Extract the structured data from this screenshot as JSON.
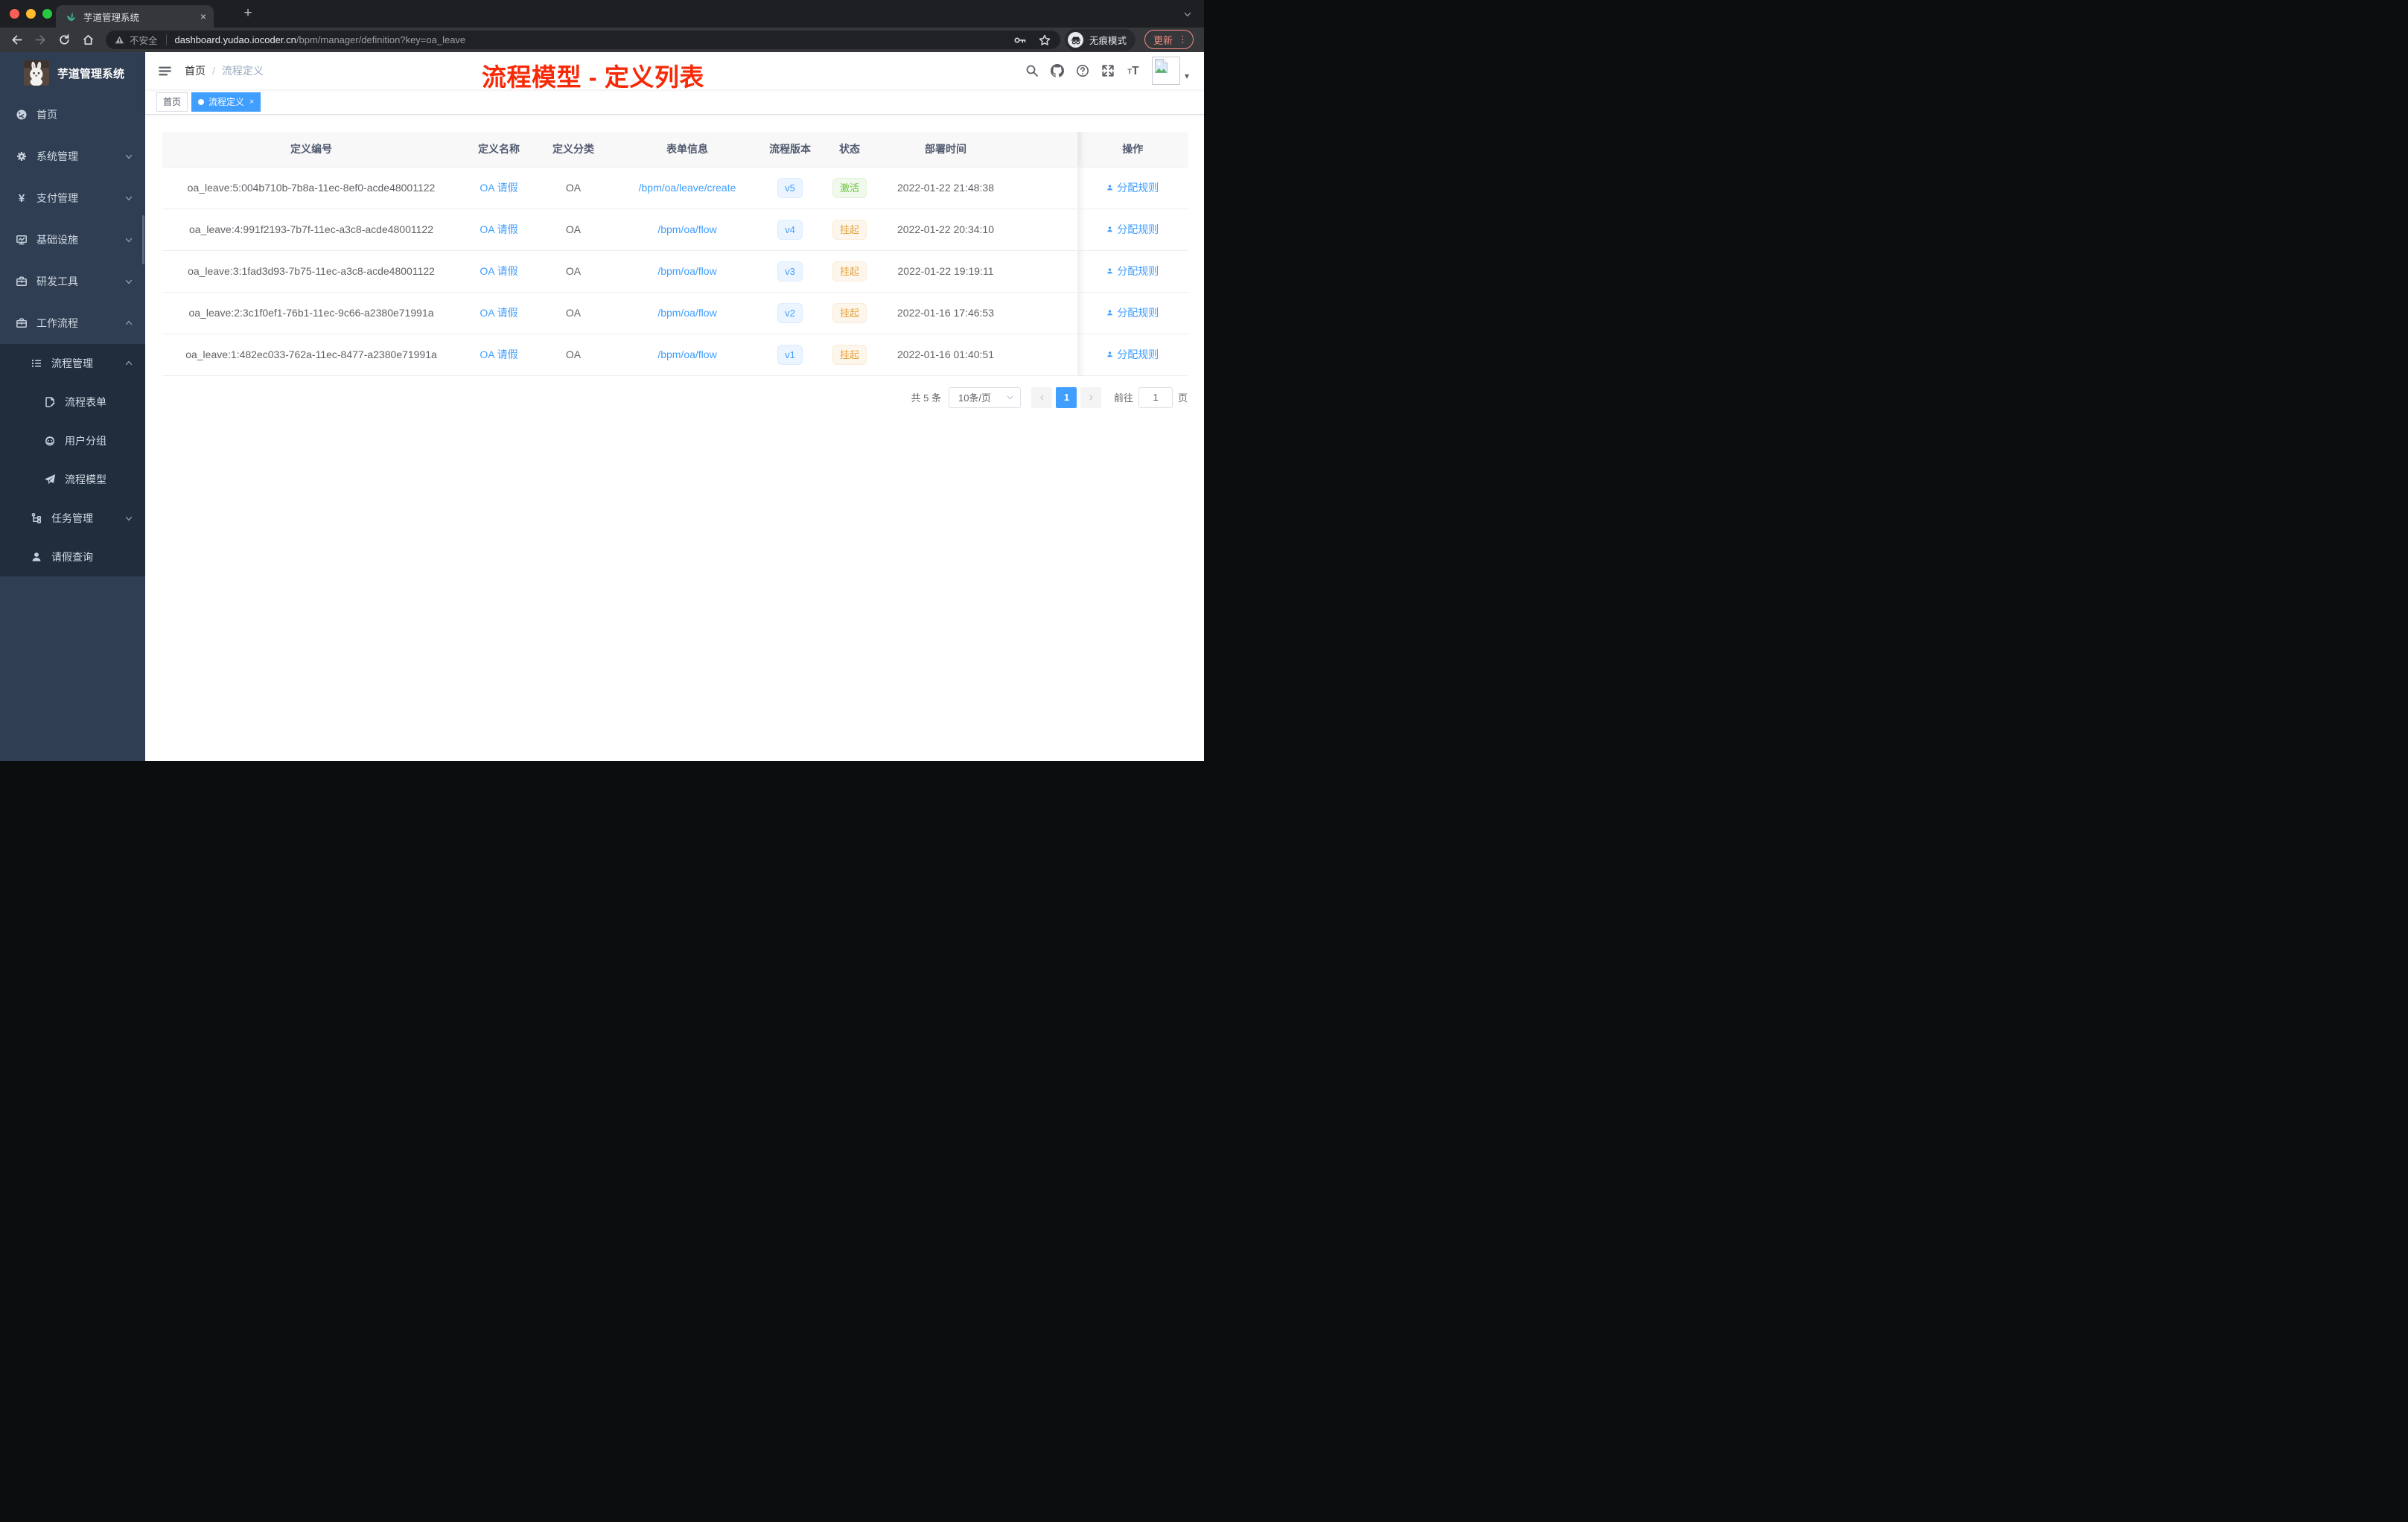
{
  "browser": {
    "tab": {
      "title": "芋道管理系统",
      "close": "×",
      "new_tab": "+",
      "favicon": "plant-icon"
    },
    "toolbar": {
      "security_label": "不安全",
      "url_host": "dashboard.yudao.iocoder.cn",
      "url_path": "/bpm/manager/definition?key=oa_leave",
      "incognito_label": "无痕模式",
      "update_label": "更新",
      "icons": [
        "back-icon",
        "forward-icon",
        "reload-icon",
        "home-icon",
        "warning-icon",
        "key-icon",
        "star-icon",
        "incognito-icon",
        "kebab-icon"
      ]
    }
  },
  "sidebar": {
    "app_title": "芋道管理系统",
    "menu": [
      {
        "label": "首页",
        "icon": "dashboard-icon",
        "arrow": null,
        "level": 0,
        "dark": false
      },
      {
        "label": "系统管理",
        "icon": "gear-icon",
        "arrow": "down",
        "level": 0,
        "dark": false
      },
      {
        "label": "支付管理",
        "icon": "yen-icon",
        "arrow": "down",
        "level": 0,
        "dark": false
      },
      {
        "label": "基础设施",
        "icon": "monitor-icon",
        "arrow": "down",
        "level": 0,
        "dark": false
      },
      {
        "label": "研发工具",
        "icon": "toolbox-icon",
        "arrow": "down",
        "level": 0,
        "dark": false
      },
      {
        "label": "工作流程",
        "icon": "briefcase-icon",
        "arrow": "up",
        "level": 0,
        "dark": false
      },
      {
        "label": "流程管理",
        "icon": "list-icon",
        "arrow": "up",
        "level": 1,
        "dark": true
      },
      {
        "label": "流程表单",
        "icon": "form-icon",
        "arrow": null,
        "level": 2,
        "dark": true
      },
      {
        "label": "用户分组",
        "icon": "robot-icon",
        "arrow": null,
        "level": 2,
        "dark": true
      },
      {
        "label": "流程模型",
        "icon": "send-icon",
        "arrow": null,
        "level": 2,
        "dark": true
      },
      {
        "label": "任务管理",
        "icon": "tree-icon",
        "arrow": "down",
        "level": 1,
        "dark": true
      },
      {
        "label": "请假查询",
        "icon": "user-icon",
        "arrow": null,
        "level": 1,
        "dark": true
      }
    ]
  },
  "header": {
    "breadcrumb": [
      "首页",
      "流程定义"
    ],
    "breadcrumb_separator": "/",
    "annotation": "流程模型 - 定义列表",
    "annotation_color": "#f72a08",
    "icons": [
      "search-icon",
      "github-icon",
      "help-icon",
      "fullscreen-icon",
      "font-size-icon",
      "avatar",
      "caret-down-icon"
    ]
  },
  "tags": [
    {
      "label": "首页",
      "active": false,
      "closable": false
    },
    {
      "label": "流程定义",
      "active": true,
      "closable": true
    }
  ],
  "table": {
    "columns": [
      "定义编号",
      "定义名称",
      "定义分类",
      "表单信息",
      "流程版本",
      "状态",
      "部署时间",
      "操作"
    ],
    "action_label": "分配规则",
    "rows": [
      {
        "id": "oa_leave:5:004b710b-7b8a-11ec-8ef0-acde48001122",
        "name": "OA 请假",
        "category": "OA",
        "form": "/bpm/oa/leave/create",
        "version": "v5",
        "status": "激活",
        "status_type": "success",
        "time": "2022-01-22 21:48:38"
      },
      {
        "id": "oa_leave:4:991f2193-7b7f-11ec-a3c8-acde48001122",
        "name": "OA 请假",
        "category": "OA",
        "form": "/bpm/oa/flow",
        "version": "v4",
        "status": "挂起",
        "status_type": "warning",
        "time": "2022-01-22 20:34:10"
      },
      {
        "id": "oa_leave:3:1fad3d93-7b75-11ec-a3c8-acde48001122",
        "name": "OA 请假",
        "category": "OA",
        "form": "/bpm/oa/flow",
        "version": "v3",
        "status": "挂起",
        "status_type": "warning",
        "time": "2022-01-22 19:19:11"
      },
      {
        "id": "oa_leave:2:3c1f0ef1-76b1-11ec-9c66-a2380e71991a",
        "name": "OA 请假",
        "category": "OA",
        "form": "/bpm/oa/flow",
        "version": "v2",
        "status": "挂起",
        "status_type": "warning",
        "time": "2022-01-16 17:46:53"
      },
      {
        "id": "oa_leave:1:482ec033-762a-11ec-8477-a2380e71991a",
        "name": "OA 请假",
        "category": "OA",
        "form": "/bpm/oa/flow",
        "version": "v1",
        "status": "挂起",
        "status_type": "warning",
        "time": "2022-01-16 01:40:51"
      }
    ]
  },
  "pagination": {
    "total": "共 5 条",
    "page_size": "10条/页",
    "prev": "‹",
    "current_page": "1",
    "next": "›",
    "goto_label": "前往",
    "goto_value": "1",
    "page_unit": "页"
  },
  "colors": {
    "primary": "#409eff",
    "success": "#67c23a",
    "warning": "#e6a23c",
    "sidebar_bg": "#2f3e52",
    "submenu_bg": "#1f2d3d",
    "table_header_bg": "#f8f8f9"
  }
}
